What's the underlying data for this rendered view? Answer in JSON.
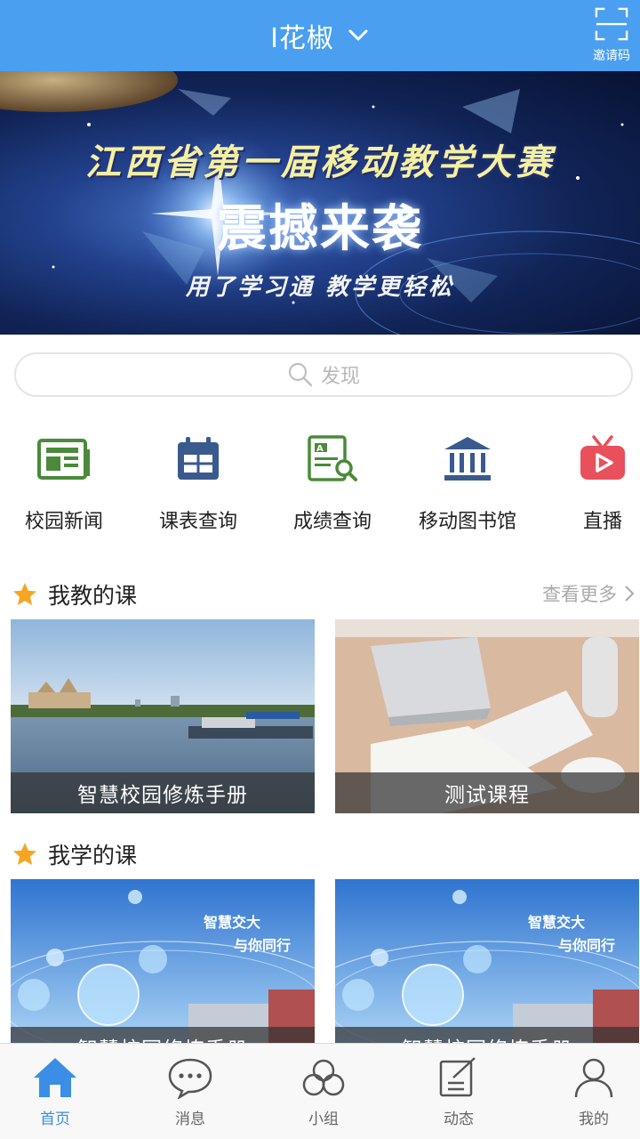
{
  "header": {
    "title": "I花椒",
    "invite_label": "邀请码"
  },
  "banner": {
    "line1": "江西省第一届移动教学大赛",
    "line2": "震撼来袭",
    "line3": "用了学习通 教学更轻松"
  },
  "search": {
    "placeholder": "发现"
  },
  "quick_menu": [
    {
      "label": "校园新闻",
      "icon": "newspaper-icon"
    },
    {
      "label": "课表查询",
      "icon": "calendar-icon"
    },
    {
      "label": "成绩查询",
      "icon": "grade-search-icon"
    },
    {
      "label": "移动图书馆",
      "icon": "library-icon"
    },
    {
      "label": "直播",
      "icon": "live-tv-icon"
    }
  ],
  "teach_section": {
    "title": "我教的课",
    "more_label": "查看更多",
    "courses": [
      {
        "title": "智慧校园修炼手册"
      },
      {
        "title": "测试课程"
      }
    ]
  },
  "learn_section": {
    "title": "我学的课",
    "courses": [
      {
        "title": "智慧校园修炼手册",
        "image_text_1": "智慧交大",
        "image_text_2": "与你同行"
      },
      {
        "title": "智慧校园修炼手册",
        "image_text_1": "智慧交大",
        "image_text_2": "与你同行"
      }
    ]
  },
  "tabbar": {
    "items": [
      {
        "label": "首页",
        "icon": "home-icon",
        "active": true
      },
      {
        "label": "消息",
        "icon": "message-icon",
        "active": false
      },
      {
        "label": "小组",
        "icon": "group-icon",
        "active": false
      },
      {
        "label": "动态",
        "icon": "post-icon",
        "active": false
      },
      {
        "label": "我的",
        "icon": "profile-icon",
        "active": false
      }
    ]
  },
  "colors": {
    "primary": "#4a9ff0",
    "star": "#f5a623",
    "tab_active": "#3a8ee6",
    "icon_green": "#4a8a3a",
    "icon_navy": "#3a5a8e",
    "icon_red": "#e8505b"
  }
}
